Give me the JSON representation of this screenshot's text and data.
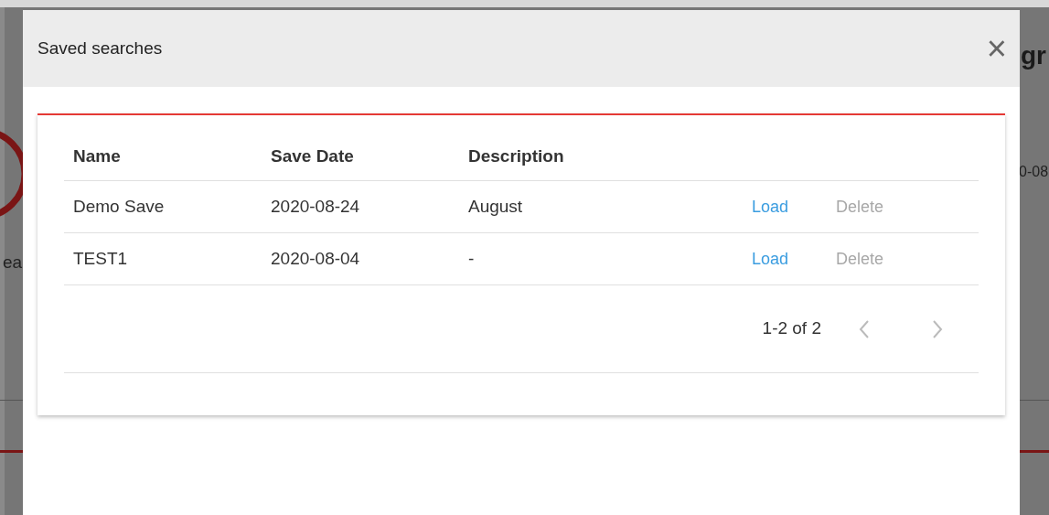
{
  "background": {
    "heading_fragment": "gr",
    "label_fragment": "ea",
    "date_fragment": "0-08"
  },
  "dialog": {
    "title": "Saved searches",
    "close": "×"
  },
  "table": {
    "columns": [
      "Name",
      "Save Date",
      "Description"
    ],
    "rows": [
      {
        "name": "Demo Save",
        "date": "2020-08-24",
        "description": "August",
        "load": "Load",
        "delete": "Delete",
        "delete_disabled": true
      },
      {
        "name": "TEST1",
        "date": "2020-08-04",
        "description": "-",
        "load": "Load",
        "delete": "Delete",
        "delete_disabled": true
      }
    ]
  },
  "pagination": {
    "range": "1-2 of 2",
    "prev_disabled": true,
    "next_disabled": true
  }
}
